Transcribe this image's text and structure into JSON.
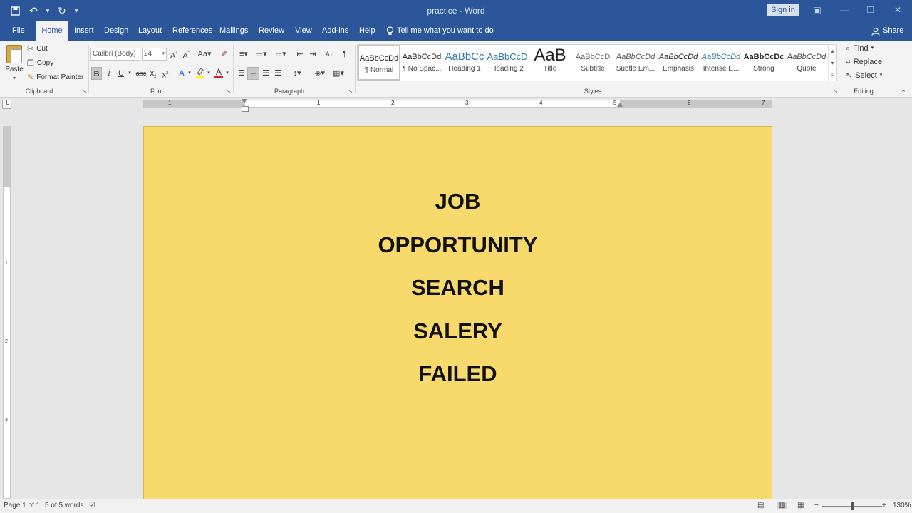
{
  "window": {
    "title": "practice  -  Word",
    "sign_in": "Sign in"
  },
  "tabs": [
    "File",
    "Home",
    "Insert",
    "Design",
    "Layout",
    "References",
    "Mailings",
    "Review",
    "View",
    "Add-ins",
    "Help"
  ],
  "active_tab": "Home",
  "tell_me": "Tell me what you want to do",
  "share": "Share",
  "clipboard": {
    "paste": "Paste",
    "cut": "Cut",
    "copy": "Copy",
    "format_painter": "Format Painter",
    "label": "Clipboard"
  },
  "font": {
    "name": "Calibri (Body)",
    "size": "24",
    "label": "Font"
  },
  "paragraph": {
    "label": "Paragraph"
  },
  "styles": {
    "label": "Styles",
    "items": [
      {
        "sample": "AaBbCcDd",
        "name": "¶ Normal"
      },
      {
        "sample": "AaBbCcDd",
        "name": "¶ No Spac..."
      },
      {
        "sample": "AaBbCc",
        "name": "Heading 1"
      },
      {
        "sample": "AaBbCcD",
        "name": "Heading 2"
      },
      {
        "sample": "AaB",
        "name": "Title"
      },
      {
        "sample": "AaBbCcD",
        "name": "Subtitle"
      },
      {
        "sample": "AaBbCcDd",
        "name": "Subtle Em..."
      },
      {
        "sample": "AaBbCcDd",
        "name": "Emphasis"
      },
      {
        "sample": "AaBbCcDd",
        "name": "Intense E..."
      },
      {
        "sample": "AaBbCcDc",
        "name": "Strong"
      },
      {
        "sample": "AaBbCcDd",
        "name": "Quote"
      }
    ]
  },
  "editing": {
    "find": "Find",
    "replace": "Replace",
    "select": "Select",
    "label": "Editing"
  },
  "ruler": {
    "h_numbers": [
      "1",
      "1",
      "2",
      "3",
      "4",
      "5",
      "6",
      "7"
    ],
    "v_numbers": [
      "1",
      "2",
      "3"
    ]
  },
  "document": {
    "lines": [
      "JOB",
      "OPPORTUNITY",
      "SEARCH",
      "SALERY",
      "FAILED"
    ],
    "page_color": "#f8da6c"
  },
  "status": {
    "page": "Page 1 of 1",
    "words": "5 of 5 words",
    "zoom": "130%"
  },
  "colors": {
    "ribbon_blue": "#2b579a",
    "highlight": "#ffff00",
    "font_color": "#d21f1f"
  }
}
